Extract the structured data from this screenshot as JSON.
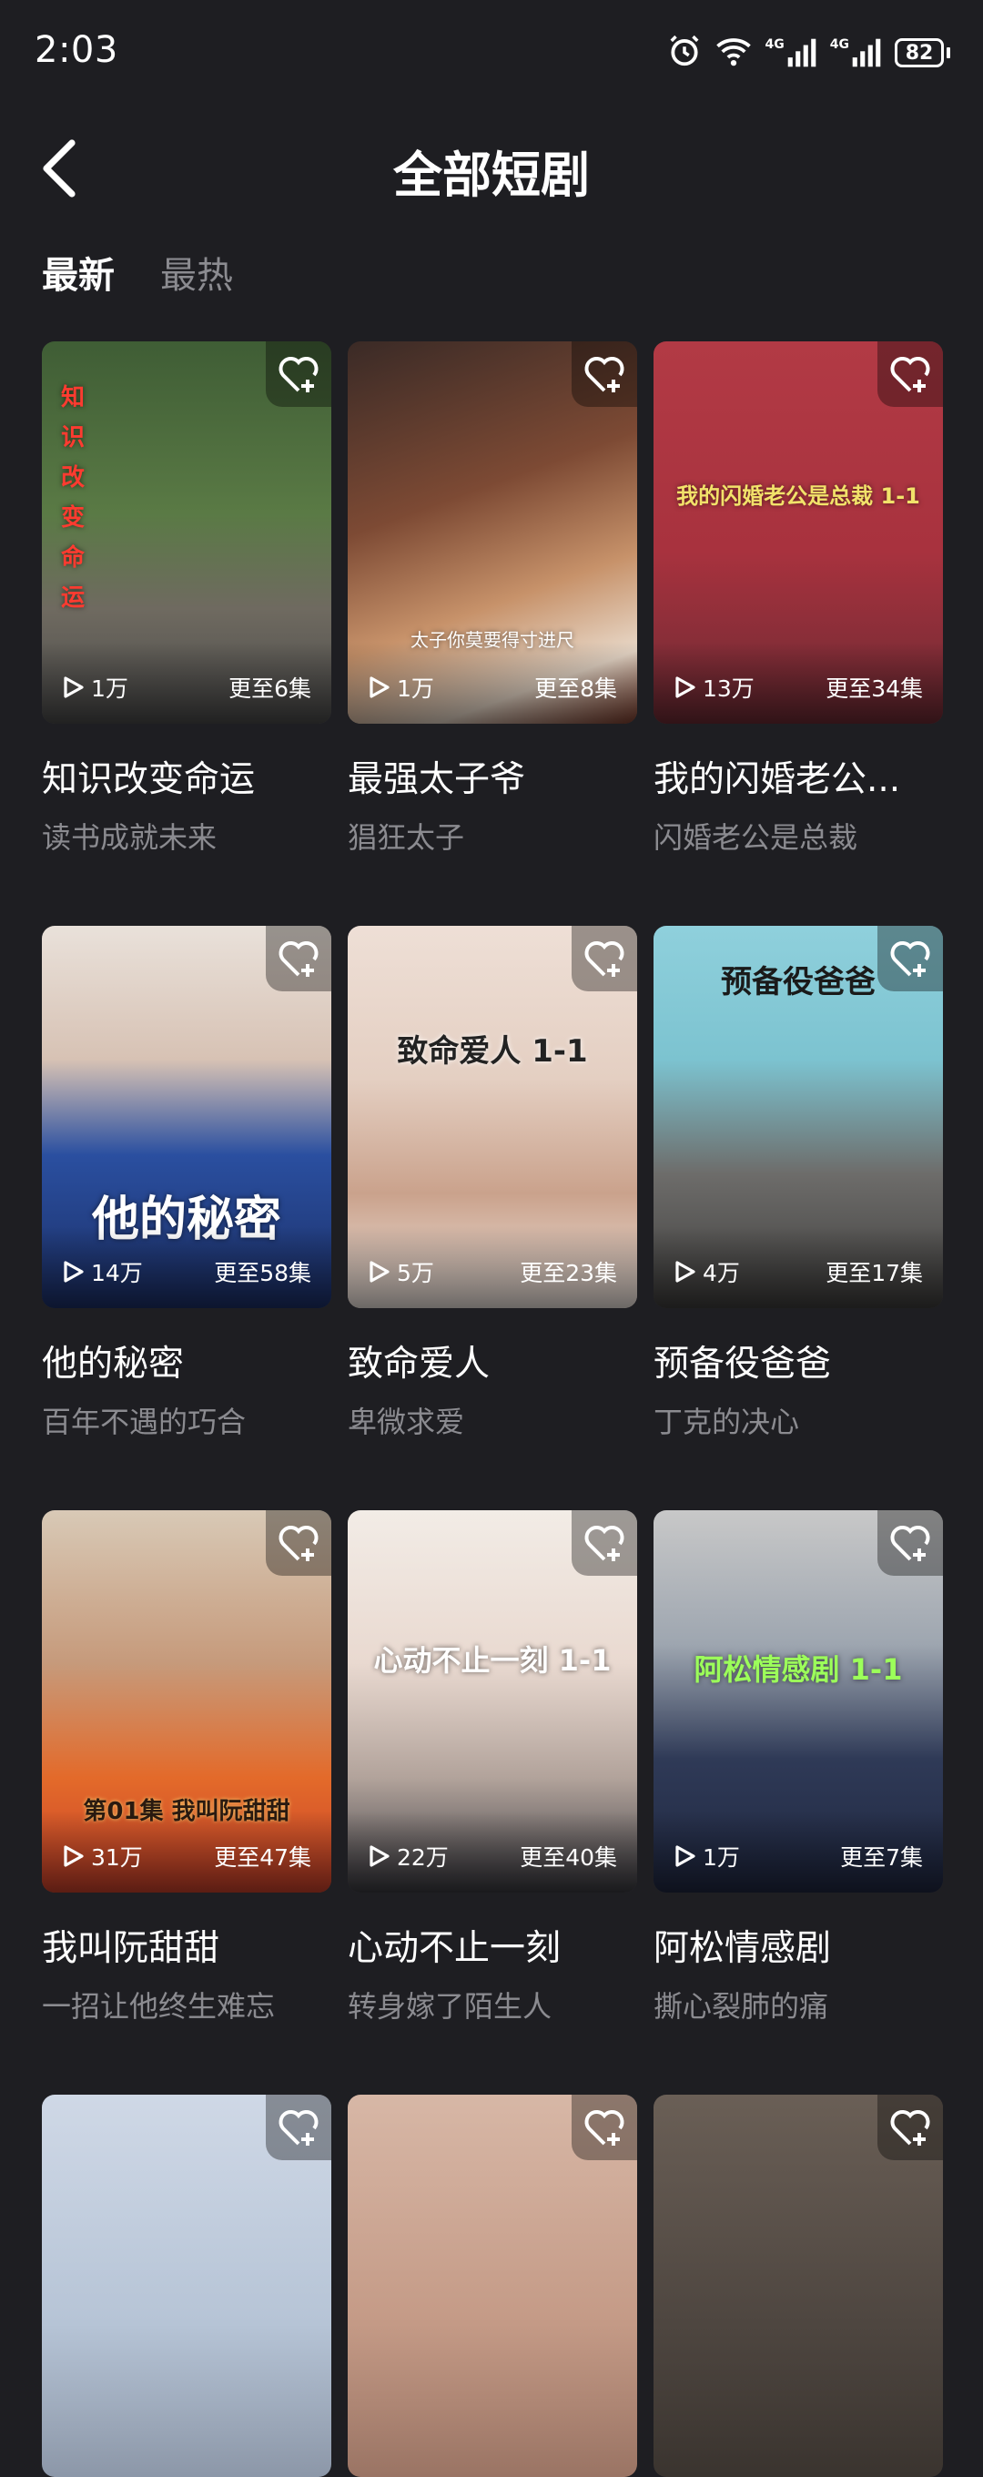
{
  "status": {
    "time": "2:03",
    "battery": "82",
    "net1": "4G",
    "net2": "4G"
  },
  "header": {
    "title": "全部短剧"
  },
  "tabs": [
    {
      "label": "最新"
    },
    {
      "label": "最热"
    }
  ],
  "cards": [
    {
      "title": "知识改变命运",
      "subtitle": "读书成就未来",
      "views": "1万",
      "episodes": "更至6集",
      "caption": "知识改变命运"
    },
    {
      "title": "最强太子爷",
      "subtitle": "猖狂太子",
      "views": "1万",
      "episodes": "更至8集",
      "caption": "太子你莫要得寸进尺"
    },
    {
      "title": "我的闪婚老公...",
      "subtitle": "闪婚老公是总裁",
      "views": "13万",
      "episodes": "更至34集",
      "caption": "我的闪婚老公是总裁 1-1"
    },
    {
      "title": "他的秘密",
      "subtitle": "百年不遇的巧合",
      "views": "14万",
      "episodes": "更至58集",
      "caption": "他的秘密"
    },
    {
      "title": "致命爱人",
      "subtitle": "卑微求爱",
      "views": "5万",
      "episodes": "更至23集",
      "caption": "致命爱人 1-1"
    },
    {
      "title": "预备役爸爸",
      "subtitle": "丁克的决心",
      "views": "4万",
      "episodes": "更至17集",
      "caption": "预备役爸爸"
    },
    {
      "title": "我叫阮甜甜",
      "subtitle": "一招让他终生难忘",
      "views": "31万",
      "episodes": "更至47集",
      "caption": "第01集 我叫阮甜甜"
    },
    {
      "title": "心动不止一刻",
      "subtitle": "转身嫁了陌生人",
      "views": "22万",
      "episodes": "更至40集",
      "caption": "心动不止一刻 1-1"
    },
    {
      "title": "阿松情感剧",
      "subtitle": "撕心裂肺的痛",
      "views": "1万",
      "episodes": "更至7集",
      "caption": "阿松情感剧 1-1"
    },
    {
      "title": "",
      "subtitle": "",
      "views": "",
      "episodes": "",
      "caption": ""
    },
    {
      "title": "",
      "subtitle": "",
      "views": "",
      "episodes": "",
      "caption": ""
    },
    {
      "title": "",
      "subtitle": "",
      "views": "",
      "episodes": "",
      "caption": ""
    }
  ],
  "icons": {
    "back": "back-arrow-icon",
    "favorite": "heart-plus-icon",
    "play": "play-icon"
  },
  "colors": {
    "background": "#1e1e22",
    "text_primary": "#ffffff",
    "text_secondary": "#8b8b90"
  }
}
